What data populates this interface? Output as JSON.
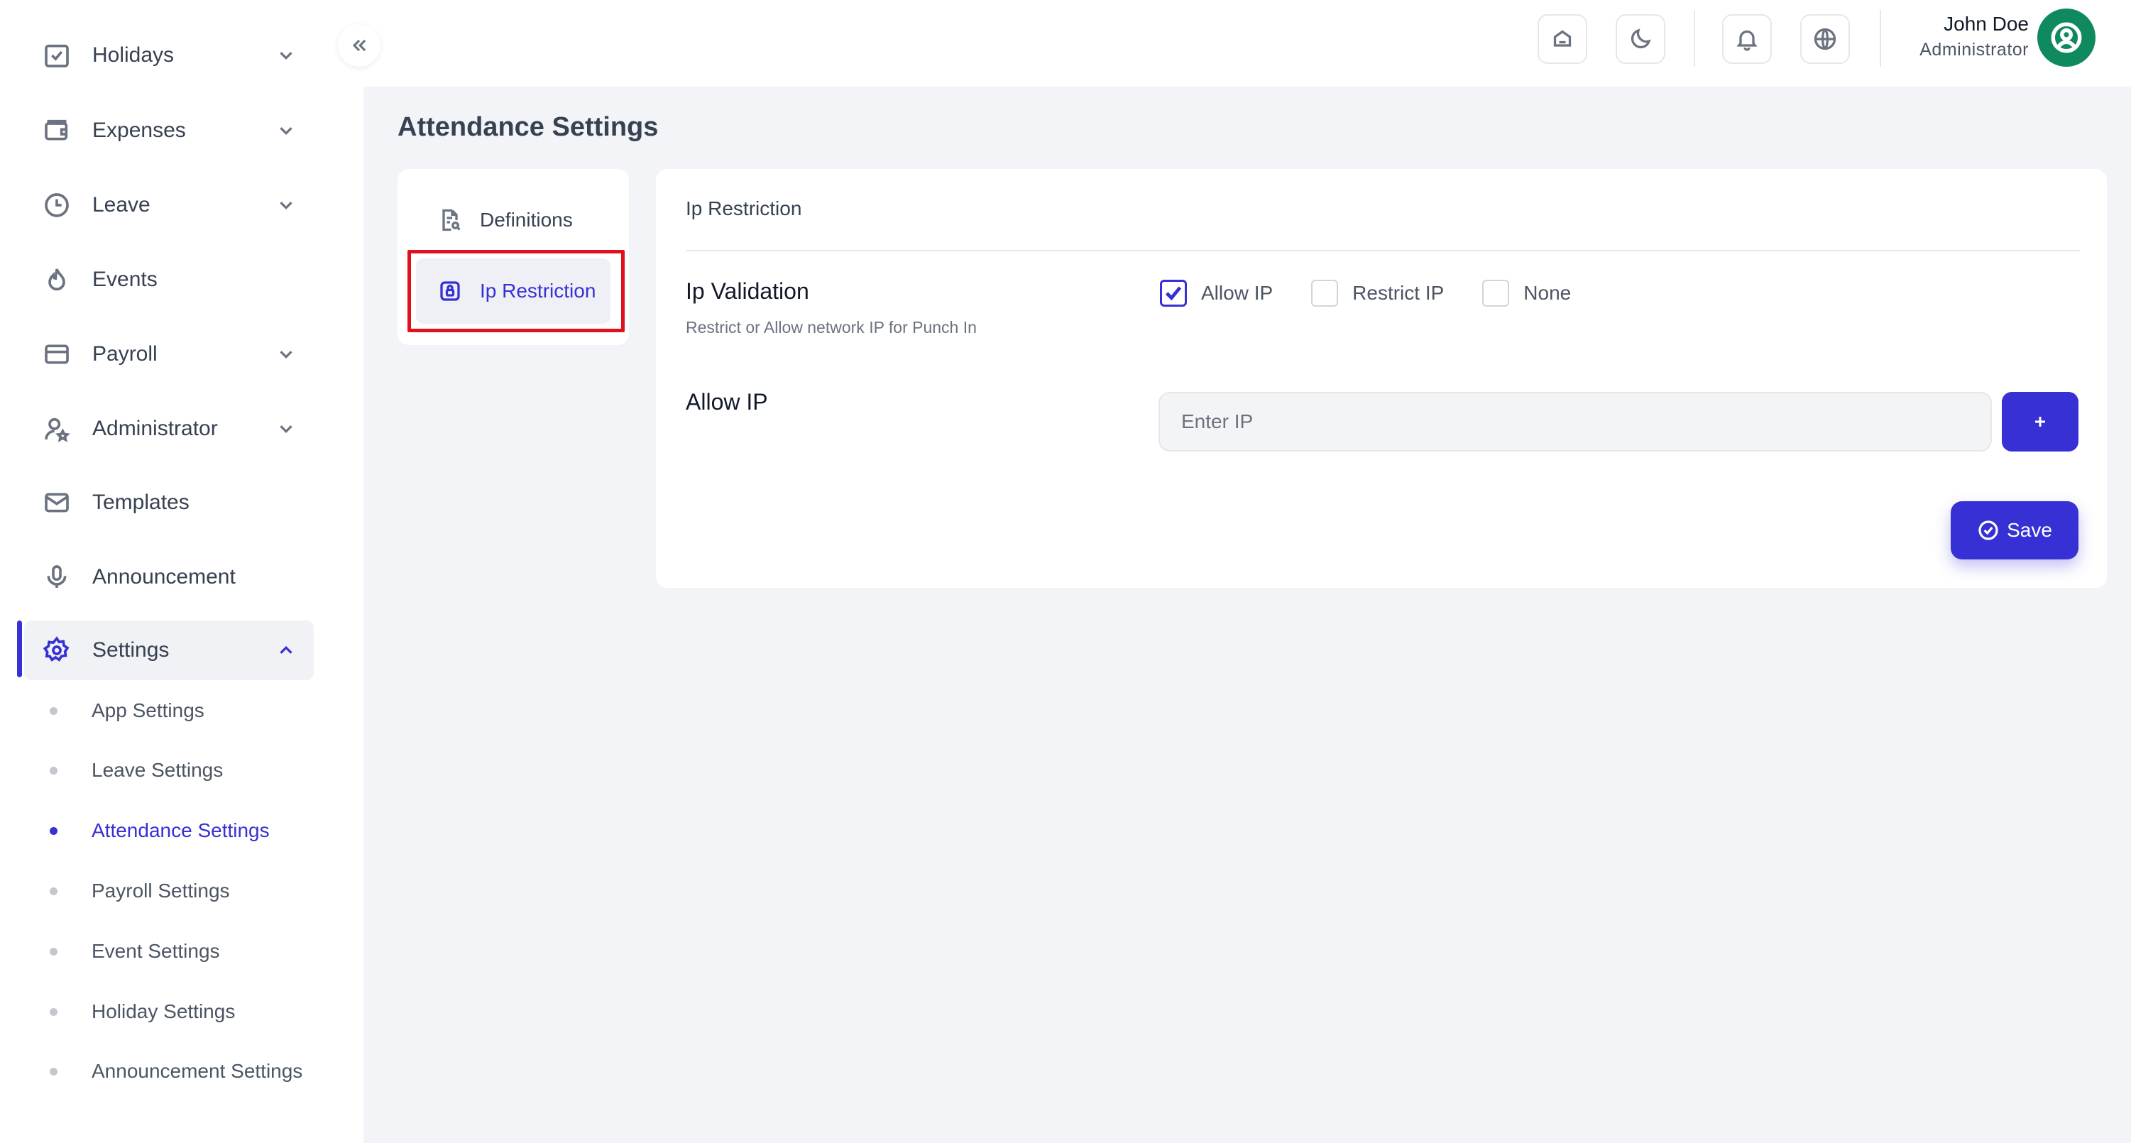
{
  "sidebar": {
    "items": [
      {
        "label": "Holidays"
      },
      {
        "label": "Expenses"
      },
      {
        "label": "Leave"
      },
      {
        "label": "Events"
      },
      {
        "label": "Payroll"
      },
      {
        "label": "Administrator"
      },
      {
        "label": "Templates"
      },
      {
        "label": "Announcement"
      },
      {
        "label": "Settings"
      }
    ],
    "settings_submenu": [
      {
        "label": "App Settings"
      },
      {
        "label": "Leave Settings"
      },
      {
        "label": "Attendance Settings"
      },
      {
        "label": "Payroll Settings"
      },
      {
        "label": "Event Settings"
      },
      {
        "label": "Holiday Settings"
      },
      {
        "label": "Announcement Settings"
      }
    ]
  },
  "header": {
    "user_name": "John Doe",
    "user_role": "Administrator"
  },
  "page": {
    "title": "Attendance Settings",
    "tabs": [
      {
        "label": "Definitions"
      },
      {
        "label": "Ip Restriction"
      }
    ],
    "card_title": "Ip Restriction",
    "ip_validation": {
      "title": "Ip Validation",
      "subtitle": "Restrict or Allow network IP for Punch In",
      "options": [
        {
          "label": "Allow IP",
          "checked": true
        },
        {
          "label": "Restrict IP",
          "checked": false
        },
        {
          "label": "None",
          "checked": false
        }
      ]
    },
    "allow_ip": {
      "title": "Allow IP",
      "placeholder": "Enter IP",
      "add_label": "+"
    },
    "save_label": "Save"
  },
  "colors": {
    "accent": "#3730d4",
    "avatar": "#0f8a5f",
    "highlight": "#e0101f"
  }
}
